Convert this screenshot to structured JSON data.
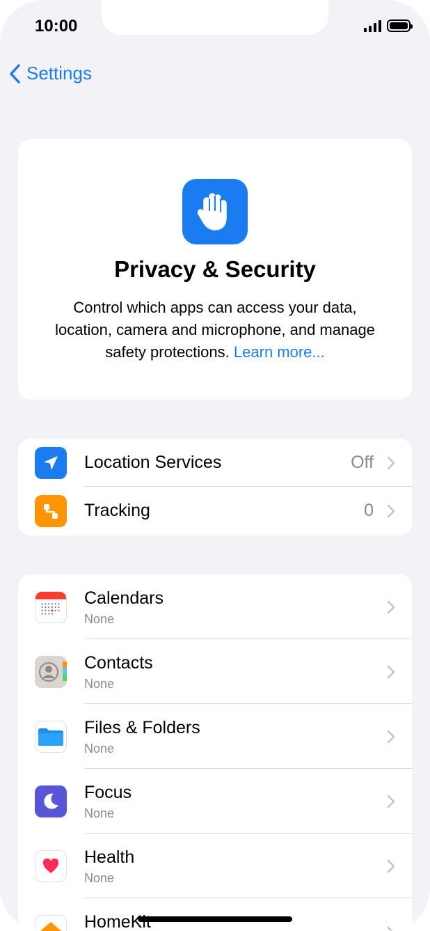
{
  "status_bar": {
    "time": "10:00"
  },
  "nav": {
    "back_label": "Settings"
  },
  "header": {
    "title": "Privacy & Security",
    "description": "Control which apps can access your data, location, camera and microphone, and manage safety protections.",
    "learn_more": "Learn more..."
  },
  "tracking_group": [
    {
      "label": "Location Services",
      "value": "Off",
      "icon": "location-arrow-icon",
      "color": "#1a7cf0"
    },
    {
      "label": "Tracking",
      "value": "0",
      "icon": "tracking-icon",
      "color": "#ff9500"
    }
  ],
  "apps_group": [
    {
      "label": "Calendars",
      "sub": "None",
      "icon": "calendar-icon"
    },
    {
      "label": "Contacts",
      "sub": "None",
      "icon": "contacts-icon"
    },
    {
      "label": "Files & Folders",
      "sub": "None",
      "icon": "folder-icon"
    },
    {
      "label": "Focus",
      "sub": "None",
      "icon": "moon-icon",
      "color": "#5856d6"
    },
    {
      "label": "Health",
      "sub": "None",
      "icon": "heart-icon",
      "color": "#ff2d55"
    },
    {
      "label": "HomeKit",
      "icon": "home-icon",
      "color": "#ff9500"
    }
  ],
  "colors": {
    "accent": "#1a7cf0",
    "background": "#f2f2f7",
    "secondary_text": "#8a8a8e"
  }
}
